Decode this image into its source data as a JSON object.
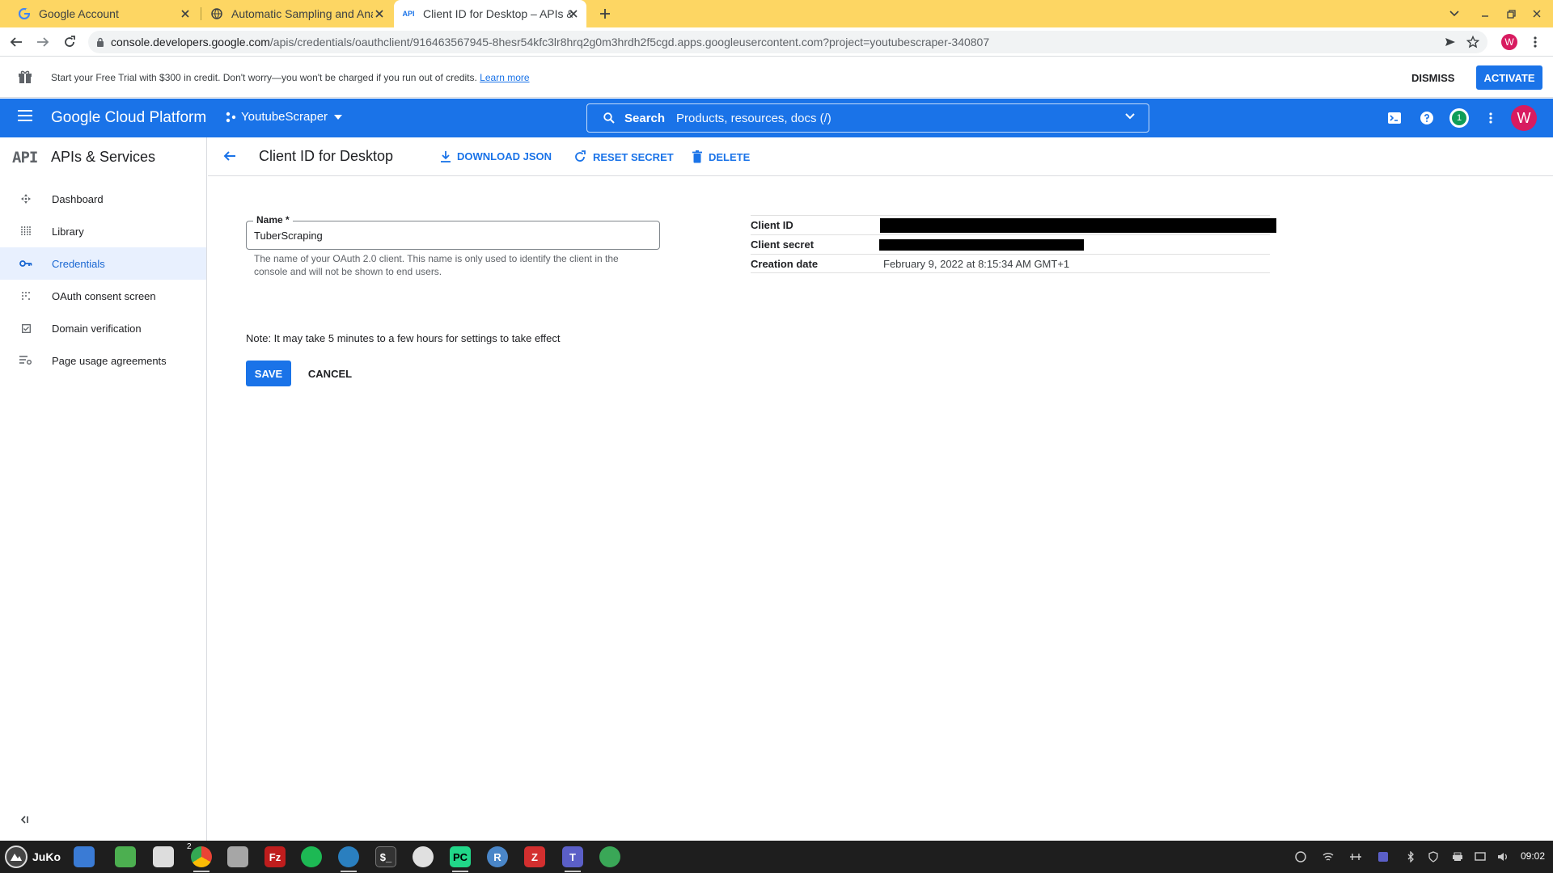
{
  "browser": {
    "tabs": [
      {
        "title": "Google Account",
        "favicon": "google-g-icon",
        "active": false
      },
      {
        "title": "Automatic Sampling and Anal",
        "favicon": "globe-icon",
        "active": false
      },
      {
        "title": "Client ID for Desktop – APIs &",
        "favicon": "api-icon",
        "active": true
      }
    ],
    "url_host": "console.developers.google.com",
    "url_rest": "/apis/credentials/oauthclient/916463567945-8hesr54kfc3lr8hrq2g0m3hrdh2f5cgd.apps.googleusercontent.com?project=youtubescraper-340807",
    "profile_initial": "W",
    "colors": {
      "tabstrip": "#fdd663",
      "accent": "#1a73e8"
    }
  },
  "banner": {
    "message": "Start your Free Trial with $300 in credit. Don't worry—you won't be charged if you run out of credits.",
    "learn_more": "Learn more",
    "dismiss": "DISMISS",
    "activate": "ACTIVATE"
  },
  "header": {
    "brand": "Google Cloud Platform",
    "project": "YoutubeScraper",
    "search_label": "Search",
    "search_placeholder": "Products, resources, docs (/)",
    "notifications": "1",
    "avatar_initial": "W"
  },
  "sidebar": {
    "logo": "API",
    "title": "APIs & Services",
    "items": [
      {
        "label": "Dashboard",
        "icon": "dashboard-icon",
        "active": false
      },
      {
        "label": "Library",
        "icon": "library-icon",
        "active": false
      },
      {
        "label": "Credentials",
        "icon": "key-icon",
        "active": true
      },
      {
        "label": "OAuth consent screen",
        "icon": "consent-icon",
        "active": false
      },
      {
        "label": "Domain verification",
        "icon": "checkbox-icon",
        "active": false
      },
      {
        "label": "Page usage agreements",
        "icon": "settings-list-icon",
        "active": false
      }
    ]
  },
  "page": {
    "title": "Client ID for Desktop",
    "actions": {
      "download": "DOWNLOAD JSON",
      "reset": "RESET SECRET",
      "delete": "DELETE"
    },
    "name_field": {
      "label": "Name *",
      "value": "TuberScraping",
      "helper": "The name of your OAuth 2.0 client. This name is only used to identify the client in the console and will not be shown to end users."
    },
    "details": {
      "client_id_label": "Client ID",
      "client_secret_label": "Client secret",
      "creation_date_label": "Creation date",
      "creation_date": "February 9, 2022 at 8:15:34 AM GMT+1"
    },
    "note": "Note: It may take 5 minutes to a few hours for settings to take effect",
    "save": "SAVE",
    "cancel": "CANCEL"
  },
  "taskbar": {
    "start_label": "JuKo",
    "badge": "2",
    "clock": "09:02"
  }
}
